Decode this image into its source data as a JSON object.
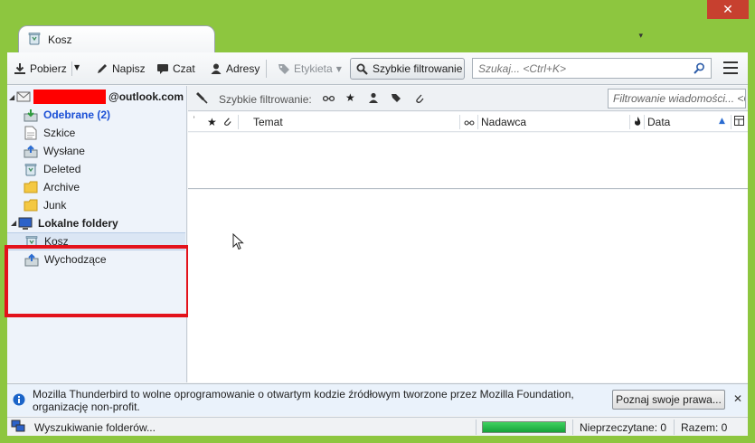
{
  "window": {
    "close_glyph": "✕",
    "tab": {
      "label": "Kosz",
      "icon": "trash-folder-icon"
    },
    "tab_menu_glyph": "▾"
  },
  "toolbar": {
    "get_mail": "Pobierz",
    "write": "Napisz",
    "chat": "Czat",
    "address_book": "Adresy",
    "tag": "Etykieta",
    "quick_filter": "Szybkie filtrowanie",
    "search_placeholder": "Szukaj... <Ctrl+K>"
  },
  "folders": {
    "account_suffix": "@outlook.com",
    "account_items": [
      {
        "label": "Odebrane (2)",
        "icon": "inbox-icon",
        "unread": true
      },
      {
        "label": "Szkice",
        "icon": "drafts-icon"
      },
      {
        "label": "Wysłane",
        "icon": "sent-icon"
      },
      {
        "label": "Deleted",
        "icon": "trash-icon"
      },
      {
        "label": "Archive",
        "icon": "folder-icon"
      },
      {
        "label": "Junk",
        "icon": "folder-icon"
      }
    ],
    "local_header": "Lokalne foldery",
    "local_items": [
      {
        "label": "Kosz",
        "icon": "trash-icon",
        "selected": true
      },
      {
        "label": "Wychodzące",
        "icon": "outbox-icon"
      }
    ]
  },
  "quickfilter": {
    "label": "Szybkie filtrowanie:",
    "filter_placeholder": "Filtrowanie wiadomości... <Ctrl+Shift+K>"
  },
  "columns": {
    "subject": "Temat",
    "sender": "Nadawca",
    "date": "Data"
  },
  "notification": {
    "text": "Mozilla Thunderbird to wolne oprogramowanie o otwartym kodzie źródłowym tworzone przez Mozilla Foundation, organizację non-profit.",
    "button": "Poznaj swoje prawa...",
    "close_glyph": "✕"
  },
  "statusbar": {
    "text": "Wyszukiwanie folderów...",
    "progress_percent": 100,
    "unread": "Nieprzeczytane: 0",
    "total": "Razem: 0"
  },
  "colors": {
    "window_frame": "#8dc63f",
    "highlight_box": "#e3121b",
    "unread_folder": "#1a4fd6",
    "progress": "#16a23a"
  }
}
